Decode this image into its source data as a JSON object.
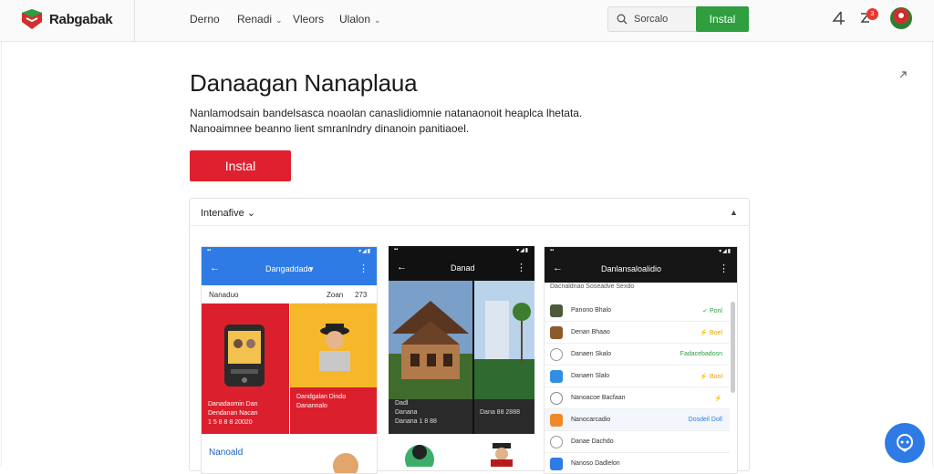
{
  "brand": {
    "name": "Rabgabak"
  },
  "nav": [
    {
      "label": "Derno",
      "dropdown": false
    },
    {
      "label": "Renadi",
      "dropdown": true
    },
    {
      "label": "Vleors",
      "dropdown": false
    },
    {
      "label": "Ulalon",
      "dropdown": true
    }
  ],
  "search": {
    "placeholder": "Sorcalo"
  },
  "header_actions": {
    "install_label": "Instal",
    "notification_count": "3"
  },
  "hero": {
    "title": "Danaagan Nanaplaua",
    "description_line1": "Nanlamodsain bandelsasca noaolan canaslidiomnie natanaonoit heaplca lhetata.",
    "description_line2": "Nanoaimnee beanno lient smranlndry dinanoin panitiaoel.",
    "install_label": "Instal"
  },
  "panel": {
    "label": "Intenafive"
  },
  "shot1": {
    "title": "Dangaddado",
    "row_label": "Nanaduo",
    "row_value_a": "Zoan",
    "row_value_b": "273",
    "tile1_caption1": "Danadaomin Dan",
    "tile1_caption2": "Dendanan Nacan",
    "tile1_caption3": "1 5 8 8 8 20020",
    "tile2_caption1": "Dandgalan Dindo",
    "tile2_caption2": "Danannalo",
    "footer_label": "Nanoald"
  },
  "shot2": {
    "title": "Danad",
    "caption1": "Dadl",
    "caption2": "Danana",
    "caption3": "Danana 1 8 88",
    "caption4": "Dana 88 2888"
  },
  "shot3": {
    "title": "Danlansaloalidio",
    "subtitle": "Dacnaldnao Soseadve Sexdo",
    "items": [
      {
        "label": "Panono Bhalo",
        "status": "✓ Ponl",
        "color": "#2e9e3f",
        "icon": "app-icon-green"
      },
      {
        "label": "Denan Bhaao",
        "status": "⚡ Boel",
        "color": "#e6a100",
        "icon": "app-icon-brown"
      },
      {
        "label": "Danaen Skalo",
        "status": "Fadacebadosn",
        "color": "#2e9e3f",
        "icon": "search-app-icon"
      },
      {
        "label": "Danaen Slalo",
        "status": "⚡ Bool",
        "color": "#e6a100",
        "icon": "app-icon-blue"
      },
      {
        "label": "Nanoacoe Bacfaan",
        "status": "⚡",
        "color": "#2f7be5",
        "icon": "gear-app-icon"
      },
      {
        "label": "Nanocarcadio",
        "status": "Dosdeil Doll",
        "color": "#2f7be5",
        "icon": "app-icon-orange"
      },
      {
        "label": "Danae Dachdo",
        "status": "",
        "color": "#777777",
        "icon": "refresh-app-icon"
      },
      {
        "label": "Nanoso Dadlelon",
        "status": "",
        "color": "#777777",
        "icon": "app-icon-blue"
      }
    ]
  },
  "colors": {
    "install_green": "#2e9e3f",
    "install_red": "#e0202e",
    "app_blue": "#2f7be5",
    "badge_red": "#e53935"
  }
}
